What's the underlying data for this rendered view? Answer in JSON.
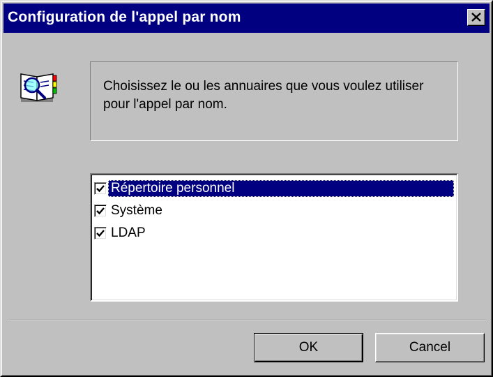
{
  "window": {
    "title": "Configuration de l'appel par nom"
  },
  "info": {
    "message": "Choisissez le ou les annuaires que vous voulez utiliser pour l'appel par nom."
  },
  "directories": {
    "items": [
      {
        "label": "Répertoire personnel",
        "checked": true,
        "selected": true
      },
      {
        "label": "Système",
        "checked": true,
        "selected": false
      },
      {
        "label": "LDAP",
        "checked": true,
        "selected": false
      }
    ]
  },
  "buttons": {
    "ok_label": "OK",
    "cancel_label": "Cancel"
  },
  "colors": {
    "titlebar": "#000080",
    "face": "#c0c0c0",
    "selection": "#000080"
  },
  "icons": {
    "app": "address-book-search-icon",
    "close": "close-icon",
    "check": "checkmark-icon"
  }
}
